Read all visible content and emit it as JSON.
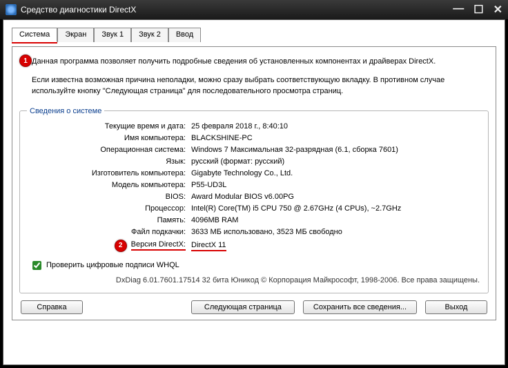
{
  "window": {
    "title": "Средство диагностики DirectX"
  },
  "tabs": {
    "system": "Система",
    "screen": "Экран",
    "sound1": "Звук 1",
    "sound2": "Звук 2",
    "input": "Ввод"
  },
  "markers": {
    "one": "1",
    "two": "2"
  },
  "intro": {
    "line1": "Данная программа позволяет получить подробные сведения об установленных компонентах и драйверах DirectX.",
    "line2": "Если известна возможная причина неполадки, можно сразу выбрать соответствующую вкладку. В противном случае используйте кнопку \"Следующая страница\" для последовательного просмотра страниц."
  },
  "sysinfo": {
    "legend": "Сведения о системе",
    "rows": {
      "time": {
        "label": "Текущие время и дата:",
        "value": "25 февраля 2018 г., 8:40:10"
      },
      "pcname": {
        "label": "Имя компьютера:",
        "value": "BLACKSHINE-PC"
      },
      "os": {
        "label": "Операционная система:",
        "value": "Windows 7 Максимальная 32-разрядная (6.1, сборка 7601)"
      },
      "lang": {
        "label": "Язык:",
        "value": "русский (формат: русский)"
      },
      "manuf": {
        "label": "Изготовитель компьютера:",
        "value": "Gigabyte Technology Co., Ltd."
      },
      "model": {
        "label": "Модель компьютера:",
        "value": "P55-UD3L"
      },
      "bios": {
        "label": "BIOS:",
        "value": "Award Modular BIOS v6.00PG"
      },
      "cpu": {
        "label": "Процессор:",
        "value": "Intel(R) Core(TM) i5 CPU       750  @ 2.67GHz (4 CPUs), ~2.7GHz"
      },
      "ram": {
        "label": "Память:",
        "value": "4096MB RAM"
      },
      "pagefile": {
        "label": "Файл подкачки:",
        "value": "3633 МБ использовано, 3523 МБ свободно"
      },
      "dx": {
        "label": "Версия DirectX:",
        "value": "DirectX 11"
      }
    }
  },
  "whql": {
    "label": "Проверить цифровые подписи WHQL"
  },
  "footer": "DxDiag 6.01.7601.17514 32 бита Юникод © Корпорация Майкрософт, 1998-2006.  Все права защищены.",
  "buttons": {
    "help": "Справка",
    "next": "Следующая страница",
    "saveall": "Сохранить все сведения...",
    "exit": "Выход"
  }
}
